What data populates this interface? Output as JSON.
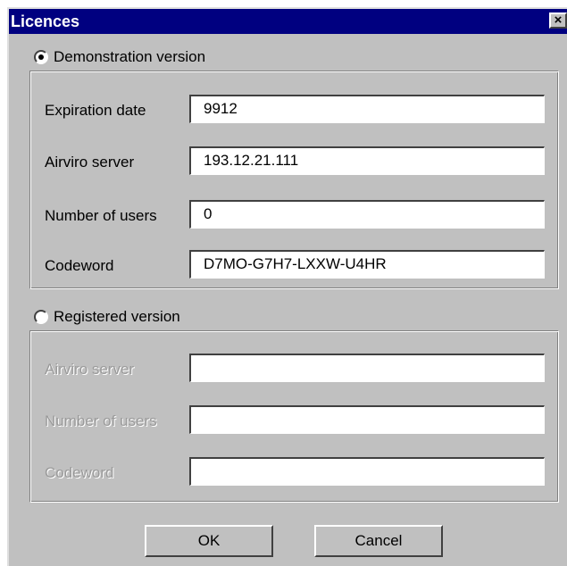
{
  "window": {
    "title": "Licences",
    "close_glyph": "×"
  },
  "demo": {
    "label": "Demonstration version",
    "selected": true,
    "fields": [
      {
        "label": "Expiration date",
        "value": "9912"
      },
      {
        "label": "Airviro server",
        "value": "193.12.21.111"
      },
      {
        "label": "Number of users",
        "value": "0"
      },
      {
        "label": "Codeword",
        "value": "D7MO-G7H7-LXXW-U4HR"
      }
    ]
  },
  "registered": {
    "label": "Registered version",
    "selected": false,
    "fields": [
      {
        "label": "Airviro server",
        "value": ""
      },
      {
        "label": "Number of users",
        "value": ""
      },
      {
        "label": "Codeword",
        "value": ""
      }
    ]
  },
  "buttons": {
    "ok": "OK",
    "cancel": "Cancel"
  }
}
